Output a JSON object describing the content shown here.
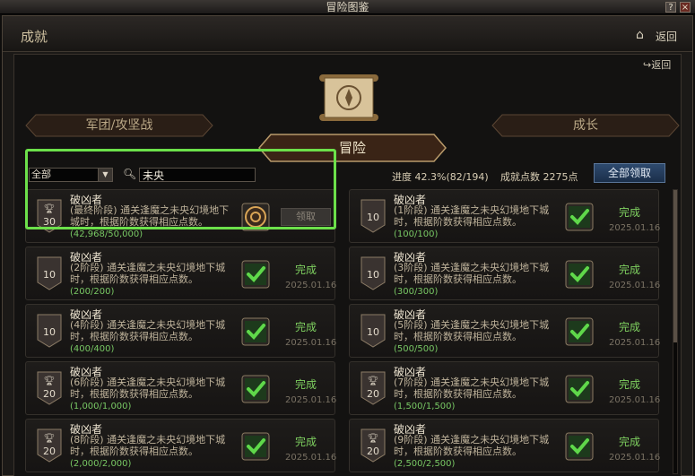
{
  "window": {
    "title": "冒险图鉴"
  },
  "header": {
    "title": "成就",
    "back_label": "返回"
  },
  "inner": {
    "back_label": "返回"
  },
  "tabs": {
    "left": "军团/攻坚战",
    "center": "冒险",
    "right": "成长"
  },
  "filter": {
    "selected": "全部"
  },
  "search": {
    "value": "未央"
  },
  "stats": {
    "progress": "进度 42.3%(82/194)",
    "points": "成就点数 2275点"
  },
  "claim_all_label": "全部领取",
  "colors": {
    "highlight": "#6ce04a",
    "complete": "#7fd160",
    "progress": "#78c864"
  },
  "cards": [
    {
      "title": "破凶者",
      "desc": "(最终阶段) 通关逢魔之未央幻境地下城时，根据阶数获得相应点数。",
      "progress": "(42,968/50,000)",
      "badge": "30",
      "trophy": true,
      "button": "领取",
      "icon": "emblem-icon"
    },
    {
      "title": "破凶者",
      "desc": "(1阶段) 通关逢魔之未央幻境地下城时，根据阶数获得相应点数。",
      "progress": "(100/100)",
      "badge": "10",
      "trophy": false,
      "status": "完成",
      "date": "2025.01.16",
      "icon": "check-icon"
    },
    {
      "title": "破凶者",
      "desc": "(2阶段) 通关逢魔之未央幻境地下城时，根据阶数获得相应点数。",
      "progress": "(200/200)",
      "badge": "10",
      "trophy": false,
      "status": "完成",
      "date": "2025.01.16",
      "icon": "check-icon"
    },
    {
      "title": "破凶者",
      "desc": "(3阶段) 通关逢魔之未央幻境地下城时，根据阶数获得相应点数。",
      "progress": "(300/300)",
      "badge": "10",
      "trophy": false,
      "status": "完成",
      "date": "2025.01.16",
      "icon": "check-icon"
    },
    {
      "title": "破凶者",
      "desc": "(4阶段) 通关逢魔之未央幻境地下城时，根据阶数获得相应点数。",
      "progress": "(400/400)",
      "badge": "10",
      "trophy": false,
      "status": "完成",
      "date": "2025.01.16",
      "icon": "check-icon"
    },
    {
      "title": "破凶者",
      "desc": "(5阶段) 通关逢魔之未央幻境地下城时，根据阶数获得相应点数。",
      "progress": "(500/500)",
      "badge": "10",
      "trophy": false,
      "status": "完成",
      "date": "2025.01.16",
      "icon": "check-icon"
    },
    {
      "title": "破凶者",
      "desc": "(6阶段) 通关逢魔之未央幻境地下城时，根据阶数获得相应点数。",
      "progress": "(1,000/1,000)",
      "badge": "20",
      "trophy": true,
      "status": "完成",
      "date": "2025.01.16",
      "icon": "check-icon"
    },
    {
      "title": "破凶者",
      "desc": "(7阶段) 通关逢魔之未央幻境地下城时，根据阶数获得相应点数。",
      "progress": "(1,500/1,500)",
      "badge": "20",
      "trophy": true,
      "status": "完成",
      "date": "2025.01.16",
      "icon": "check-icon"
    },
    {
      "title": "破凶者",
      "desc": "(8阶段) 通关逢魔之未央幻境地下城时，根据阶数获得相应点数。",
      "progress": "(2,000/2,000)",
      "badge": "20",
      "trophy": true,
      "status": "完成",
      "date": "2025.01.16",
      "icon": "check-icon"
    },
    {
      "title": "破凶者",
      "desc": "(9阶段) 通关逢魔之未央幻境地下城时，根据阶数获得相应点数。",
      "progress": "(2,500/2,500)",
      "badge": "20",
      "trophy": true,
      "status": "完成",
      "date": "2025.01.16",
      "icon": "check-icon"
    }
  ]
}
